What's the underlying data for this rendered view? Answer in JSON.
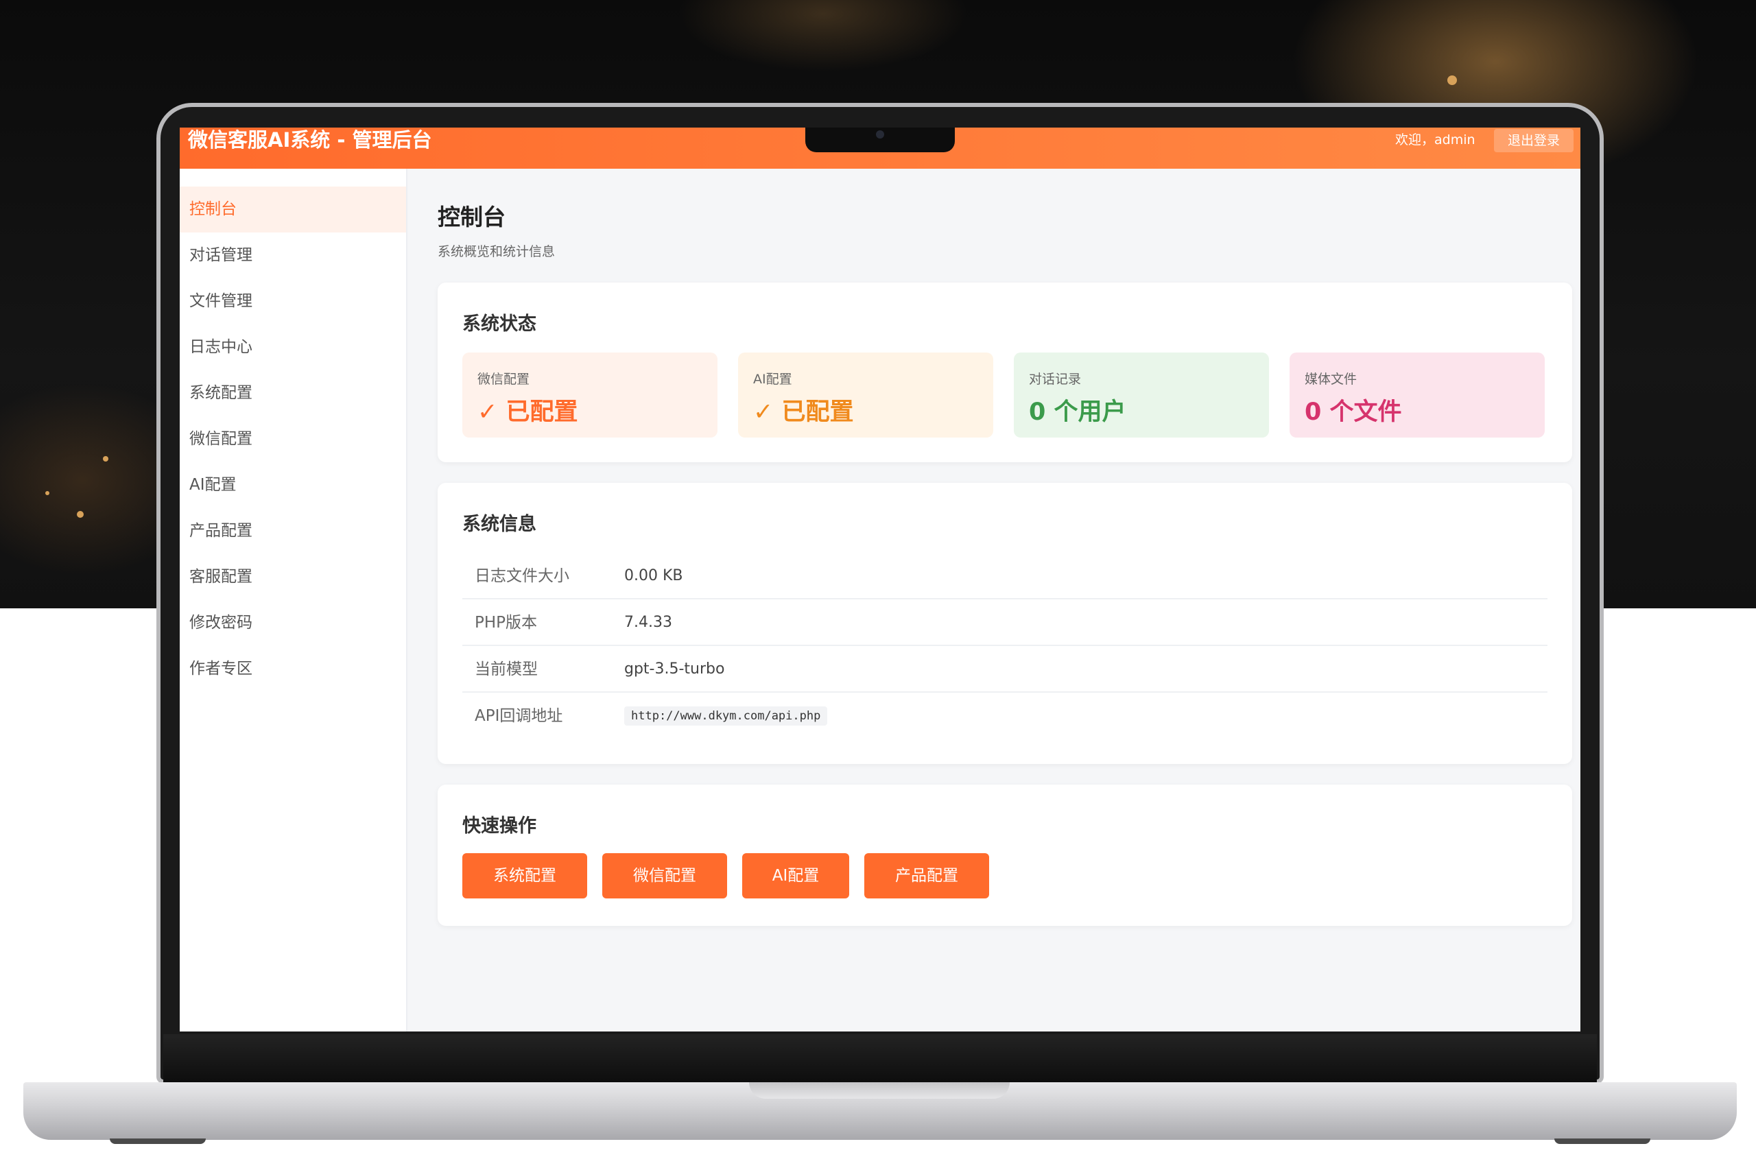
{
  "app": {
    "title": "微信客服AI系统 - 管理后台",
    "welcome": "欢迎，admin",
    "logout": "退出登录"
  },
  "sidebar": {
    "items": [
      {
        "label": "控制台",
        "active": true
      },
      {
        "label": "对话管理"
      },
      {
        "label": "文件管理"
      },
      {
        "label": "日志中心"
      },
      {
        "label": "系统配置"
      },
      {
        "label": "微信配置"
      },
      {
        "label": "AI配置"
      },
      {
        "label": "产品配置"
      },
      {
        "label": "客服配置"
      },
      {
        "label": "修改密码"
      },
      {
        "label": "作者专区"
      }
    ]
  },
  "page": {
    "title": "控制台",
    "subtitle": "系统概览和统计信息"
  },
  "status": {
    "title": "系统状态",
    "cards": [
      {
        "label": "微信配置",
        "value": "✓ 已配置",
        "color": "#ff6b2c"
      },
      {
        "label": "AI配置",
        "value": "✓ 已配置",
        "color": "#f08a1d"
      },
      {
        "label": "对话记录",
        "value": "0 个用户",
        "color": "#3b9b4b"
      },
      {
        "label": "媒体文件",
        "value": "0 个文件",
        "color": "#d6336c"
      }
    ]
  },
  "info": {
    "title": "系统信息",
    "rows": [
      {
        "label": "日志文件大小",
        "value": "0.00 KB"
      },
      {
        "label": "PHP版本",
        "value": "7.4.33"
      },
      {
        "label": "当前模型",
        "value": "gpt-3.5-turbo"
      },
      {
        "label": "API回调地址",
        "value": "http://www.dkym.com/api.php"
      }
    ]
  },
  "quick": {
    "title": "快速操作",
    "buttons": [
      "系统配置",
      "微信配置",
      "AI配置",
      "产品配置"
    ]
  },
  "colors": {
    "accent": "#ff6b2c",
    "card_bg": [
      "#fff2eb",
      "#fff4e6",
      "#e9f6ea",
      "#fce4ec"
    ]
  }
}
